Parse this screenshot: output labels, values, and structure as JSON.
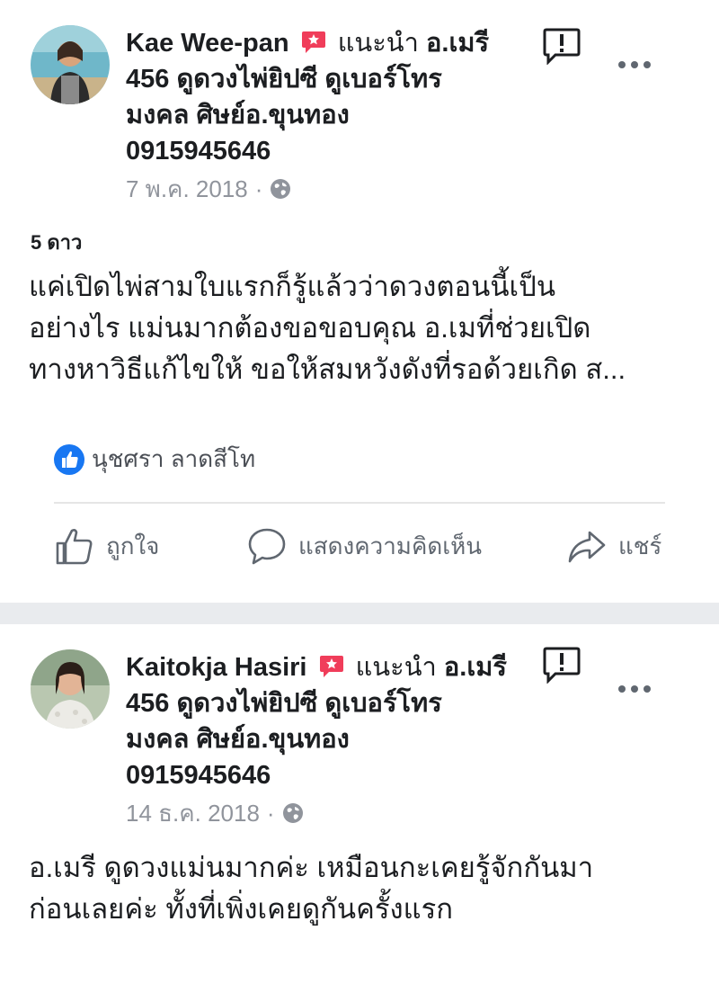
{
  "posts": [
    {
      "author": "Kae Wee-pan",
      "recommend_word": "แนะนำ",
      "recommend_text_1": "อ.เมรี",
      "recommend_text_2": "456 ดูดวงไพ่ยิปซี ดูเบอร์โทร",
      "recommend_text_3": "มงคล ศิษย์อ.ขุนทอง",
      "recommend_text_4": "0915945646",
      "date": "7 พ.ค. 2018",
      "separator_dot": "·",
      "rating": "5 ดาว",
      "body_lines": [
        "แค่เปิดไพ่สามใบแรกก็รู้แล้วว่าดวงตอนนี้เป็น",
        "อย่างไร แม่นมากต้องขอขอบคุณ อ.เมที่ช่วยเปิด",
        "ทางหาวิธีแก้ไขให้ ขอให้สมหวังดังที่รอด้วยเกิด ส..."
      ],
      "reaction_name": "นุชศรา ลาดสีโท"
    },
    {
      "author": "Kaitokja Hasiri",
      "recommend_word": "แนะนำ",
      "recommend_text_1": "อ.เมรี",
      "recommend_text_2": "456 ดูดวงไพ่ยิปซี ดูเบอร์โทร",
      "recommend_text_3": "มงคล ศิษย์อ.ขุนทอง",
      "recommend_text_4": "0915945646",
      "date": "14 ธ.ค. 2018",
      "separator_dot": "·",
      "body_lines": [
        "อ.เมรี ดูดวงแม่นมากค่ะ เหมือนกะเคยรู้จักกันมา",
        "ก่อนเลยค่ะ ทั้งที่เพิ่งเคยดูกันครั้งแรก"
      ]
    }
  ],
  "actions": {
    "like": "ถูกใจ",
    "comment": "แสดงความคิดเห็น",
    "share": "แชร์"
  },
  "icons": {
    "recommend": "recommend-badge-icon",
    "globe": "globe-icon",
    "report": "report-icon",
    "more": "more-dots-icon",
    "like_reaction": "like-reaction-icon",
    "thumb": "thumbs-up-icon",
    "comment": "comment-icon",
    "share": "share-arrow-icon"
  },
  "colors": {
    "accent": "#1877f2",
    "recommend": "#f03d5a",
    "meta": "#90949c",
    "separator": "#e9ebee"
  }
}
